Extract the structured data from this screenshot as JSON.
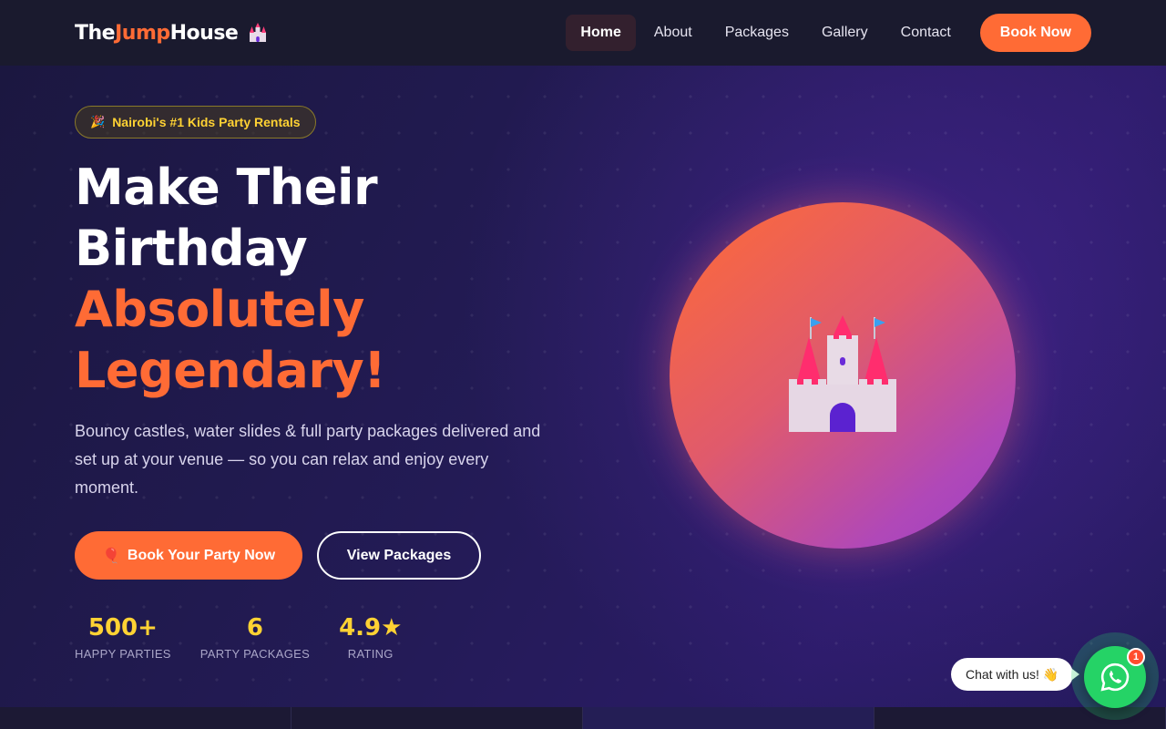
{
  "nav": {
    "logo": {
      "part1": "The ",
      "part2": "Jump",
      "part3": "House"
    },
    "links": [
      "Home",
      "About",
      "Packages",
      "Gallery",
      "Contact"
    ],
    "active_link": "Home",
    "cta": "Book Now"
  },
  "hero": {
    "badge": "Nairobi's #1 Kids Party Rentals",
    "headline_line1": "Make Their",
    "headline_line2": "Birthday",
    "headline_line3": "Absolutely",
    "headline_line4": "Legendary!",
    "lead": "Bouncy castles, water slides & full party packages delivered and set up at your venue — so you can relax and enjoy every moment.",
    "primary_button": "Book Your Party Now",
    "secondary_button": "View Packages",
    "stats": [
      {
        "value": "500+",
        "label": "HAPPY PARTIES"
      },
      {
        "value": "6",
        "label": "PARTY PACKAGES"
      },
      {
        "value": "4.9★",
        "label": "RATING"
      }
    ]
  },
  "chat": {
    "bubble": "Chat with us! 👋",
    "badge_count": "1"
  },
  "colors": {
    "accent": "#ff6b35",
    "highlight": "#ffd233",
    "whatsapp": "#25d366",
    "nav_bg": "#1a1a2e"
  }
}
